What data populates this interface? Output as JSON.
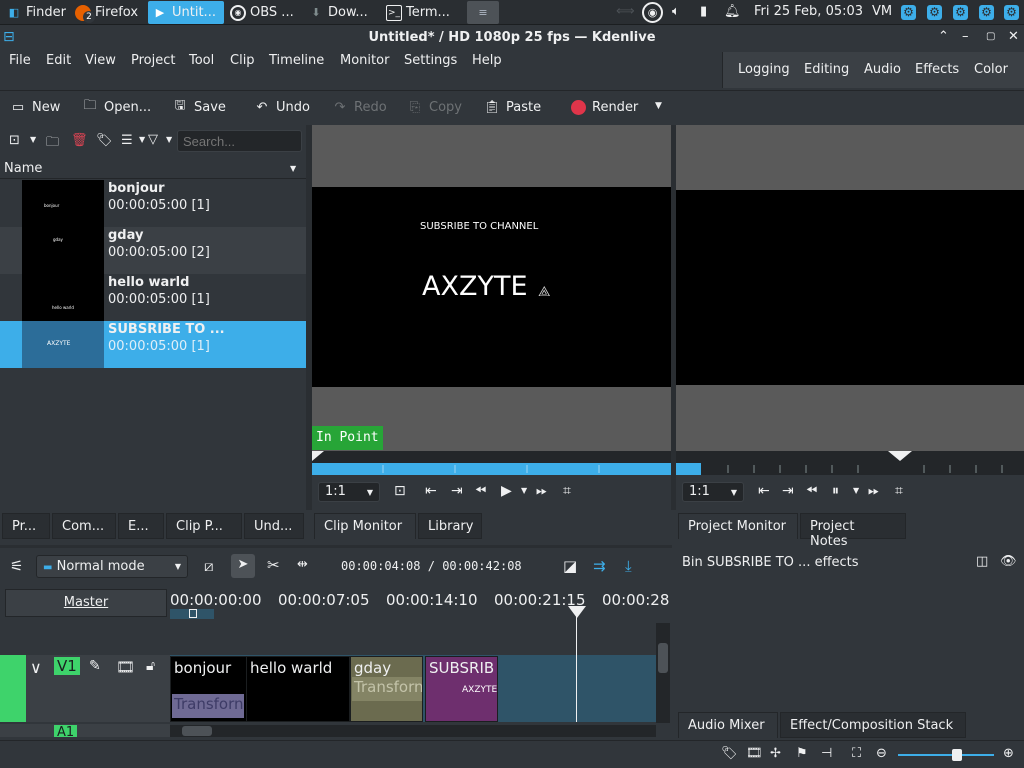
{
  "taskbar": {
    "tasks": [
      {
        "label": "Finder"
      },
      {
        "label": "Firefox",
        "badge": "2"
      },
      {
        "label": "Untit..."
      },
      {
        "label": "OBS ..."
      },
      {
        "label": "Dow..."
      },
      {
        "label": "Term..."
      }
    ],
    "clock": "Fri 25 Feb, 05:03",
    "user": "VM"
  },
  "window": {
    "title": "Untitled* / HD 1080p 25 fps — Kdenlive"
  },
  "menu": [
    "File",
    "Edit",
    "View",
    "Project",
    "Tool",
    "Clip",
    "Timeline",
    "Monitor",
    "Settings",
    "Help"
  ],
  "layouts": [
    "Logging",
    "Editing",
    "Audio",
    "Effects",
    "Color"
  ],
  "toolbar": {
    "new": "New",
    "open": "Open...",
    "save": "Save",
    "undo": "Undo",
    "redo": "Redo",
    "copy": "Copy",
    "paste": "Paste",
    "render": "Render"
  },
  "bin": {
    "search_placeholder": "Search...",
    "column": "Name",
    "items": [
      {
        "name": "bonjour",
        "duration": "00:00:05:00 [1]"
      },
      {
        "name": "gday",
        "duration": "00:00:05:00 [2]"
      },
      {
        "name": "hello warld",
        "duration": "00:00:05:00 [1]"
      },
      {
        "name": "SUBSRIBE TO ...",
        "duration": "00:00:05:00 [1]"
      }
    ],
    "thumb_text": "AXZYTE"
  },
  "clip_monitor": {
    "subtitle": "SUBSRIBE TO CHANNEL",
    "title": "AXZYTE",
    "in_point": "In Point",
    "ratio": "1:1",
    "progress_fraction": 1.0
  },
  "project_monitor": {
    "ratio": "1:1"
  },
  "left_tabs": [
    "Pr...",
    "Com...",
    "E...",
    "Clip P...",
    "Und..."
  ],
  "monitor_tabs": [
    "Clip Monitor",
    "Library"
  ],
  "project_tabs": [
    "Project Monitor",
    "Project Notes"
  ],
  "effects": {
    "header": "Bin SUBSRIBE TO ... effects"
  },
  "timeline": {
    "mode": "Normal mode",
    "timecode_current": "00:00:04:08",
    "timecode_separator": "/",
    "timecode_total": "00:00:42:08",
    "master": "Master",
    "ruler": [
      "00:00:00:00",
      "00:00:07:05",
      "00:00:14:10",
      "00:00:21:15",
      "00:00:28"
    ],
    "tracks": [
      {
        "name": "V1"
      },
      {
        "name": "A1"
      }
    ],
    "clips": [
      {
        "label": "bonjour",
        "transition": "Transforn"
      },
      {
        "label": "hello warld"
      },
      {
        "label": "gday",
        "transition": "Transforn"
      },
      {
        "label": "SUBSRIB",
        "sublabel": "AXZYTE"
      }
    ]
  },
  "bottom_tabs": [
    "Audio Mixer",
    "Effect/Composition Stack"
  ],
  "colors": {
    "accent": "#3daee9",
    "in_point": "#27a537",
    "track_green": "#3ed36b",
    "clip_gday": "#6b6b4f",
    "clip_sub": "#6e2f6e",
    "timeline_empty": "#2f5468"
  }
}
